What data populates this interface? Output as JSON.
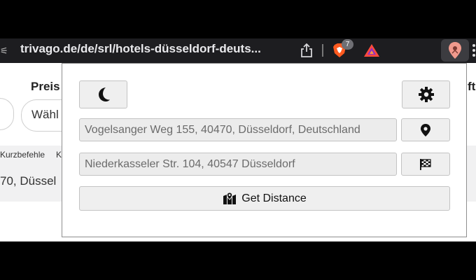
{
  "browser": {
    "url": "trivago.de/de/srl/hotels-düsseldorf-deuts...",
    "brave_badge_count": "7"
  },
  "page": {
    "filter_label": "Preis",
    "select_text": "Wähl",
    "right_fragment": "ft",
    "shortcuts_label": "Kurzbefehle",
    "shortcuts_fragment": "K",
    "address_fragment": "70, Düssel"
  },
  "popup": {
    "start_value": "Vogelsanger Weg 155,  40470,  Düsseldorf,  Deutschland",
    "destination_value": "Niederkasseler Str. 104, 40547 Düsseldorf",
    "get_distance_label": "Get Distance",
    "icons": [
      "moon-icon",
      "gear-icon",
      "map-marker-icon",
      "checkered-flag-icon",
      "map-icon"
    ]
  }
}
